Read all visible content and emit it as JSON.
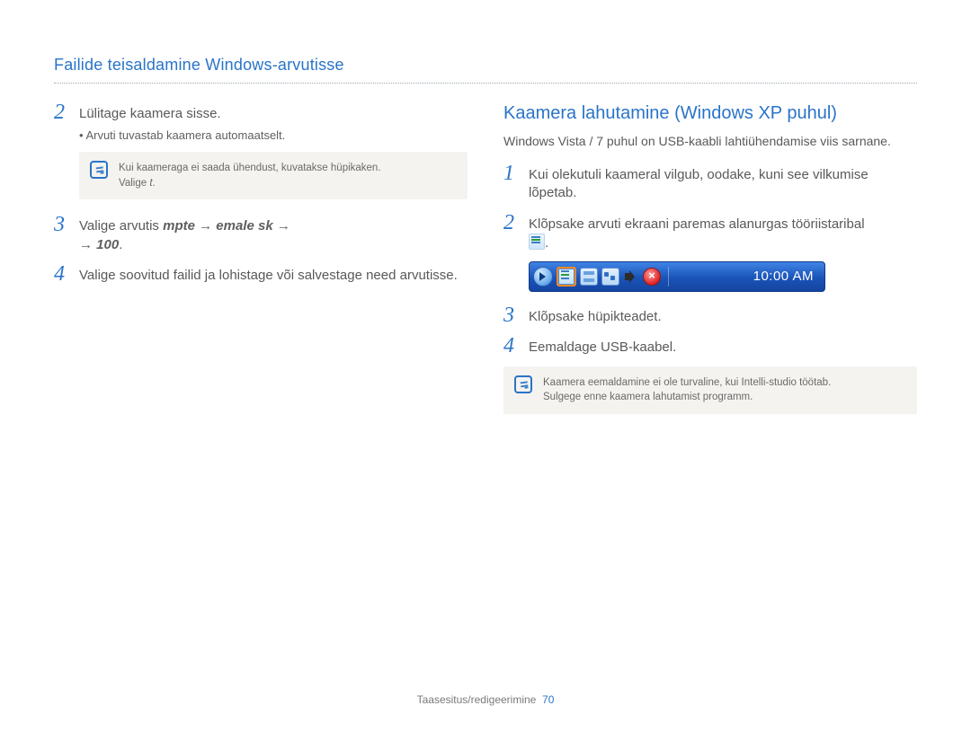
{
  "pageTitle": "Failide teisaldamine Windows-arvutisse",
  "left": {
    "step2": {
      "num": "2",
      "text": "Lülitage kaamera sisse.",
      "sub": "Arvuti tuvastab kaamera automaatselt."
    },
    "note": {
      "line1": "Kui kaameraga ei saada ühendust, kuvatakse hüpikaken.",
      "line2a": "Valige ",
      "line2b": "t",
      "line2c": "."
    },
    "step3": {
      "num": "3",
      "lead": "Valige arvutis ",
      "seg1": "mpte",
      "arrow1": " → ",
      "seg2": "emale sk",
      "arrow2": " → ",
      "arrow3": "→ ",
      "seg3": "100",
      "tail": "."
    },
    "step4": {
      "num": "4",
      "text": "Valige soovitud failid ja lohistage või salvestage need arvutisse."
    }
  },
  "right": {
    "sectionTitle": "Kaamera lahutamine (Windows XP puhul)",
    "lead": "Windows Vista / 7 puhul on USB-kaabli lahtiühendamise viis sarnane.",
    "step1": {
      "num": "1",
      "text": "Kui olekutuli kaameral vilgub, oodake, kuni see vilkumise lõpetab."
    },
    "step2": {
      "num": "2",
      "text": "Klõpsake arvuti ekraani paremas alanurgas tööriistaribal ",
      "tail": "."
    },
    "tray": {
      "clock": "10:00 AM"
    },
    "step3": {
      "num": "3",
      "text": "Klõpsake hüpikteadet."
    },
    "step4": {
      "num": "4",
      "text": "Eemaldage USB-kaabel."
    },
    "note": {
      "line1": "Kaamera eemaldamine ei ole turvaline, kui Intelli-studio töötab.",
      "line2": "Sulgege enne kaamera lahutamist programm."
    }
  },
  "footer": {
    "section": "Taasesitus/redigeerimine",
    "page": "70"
  }
}
